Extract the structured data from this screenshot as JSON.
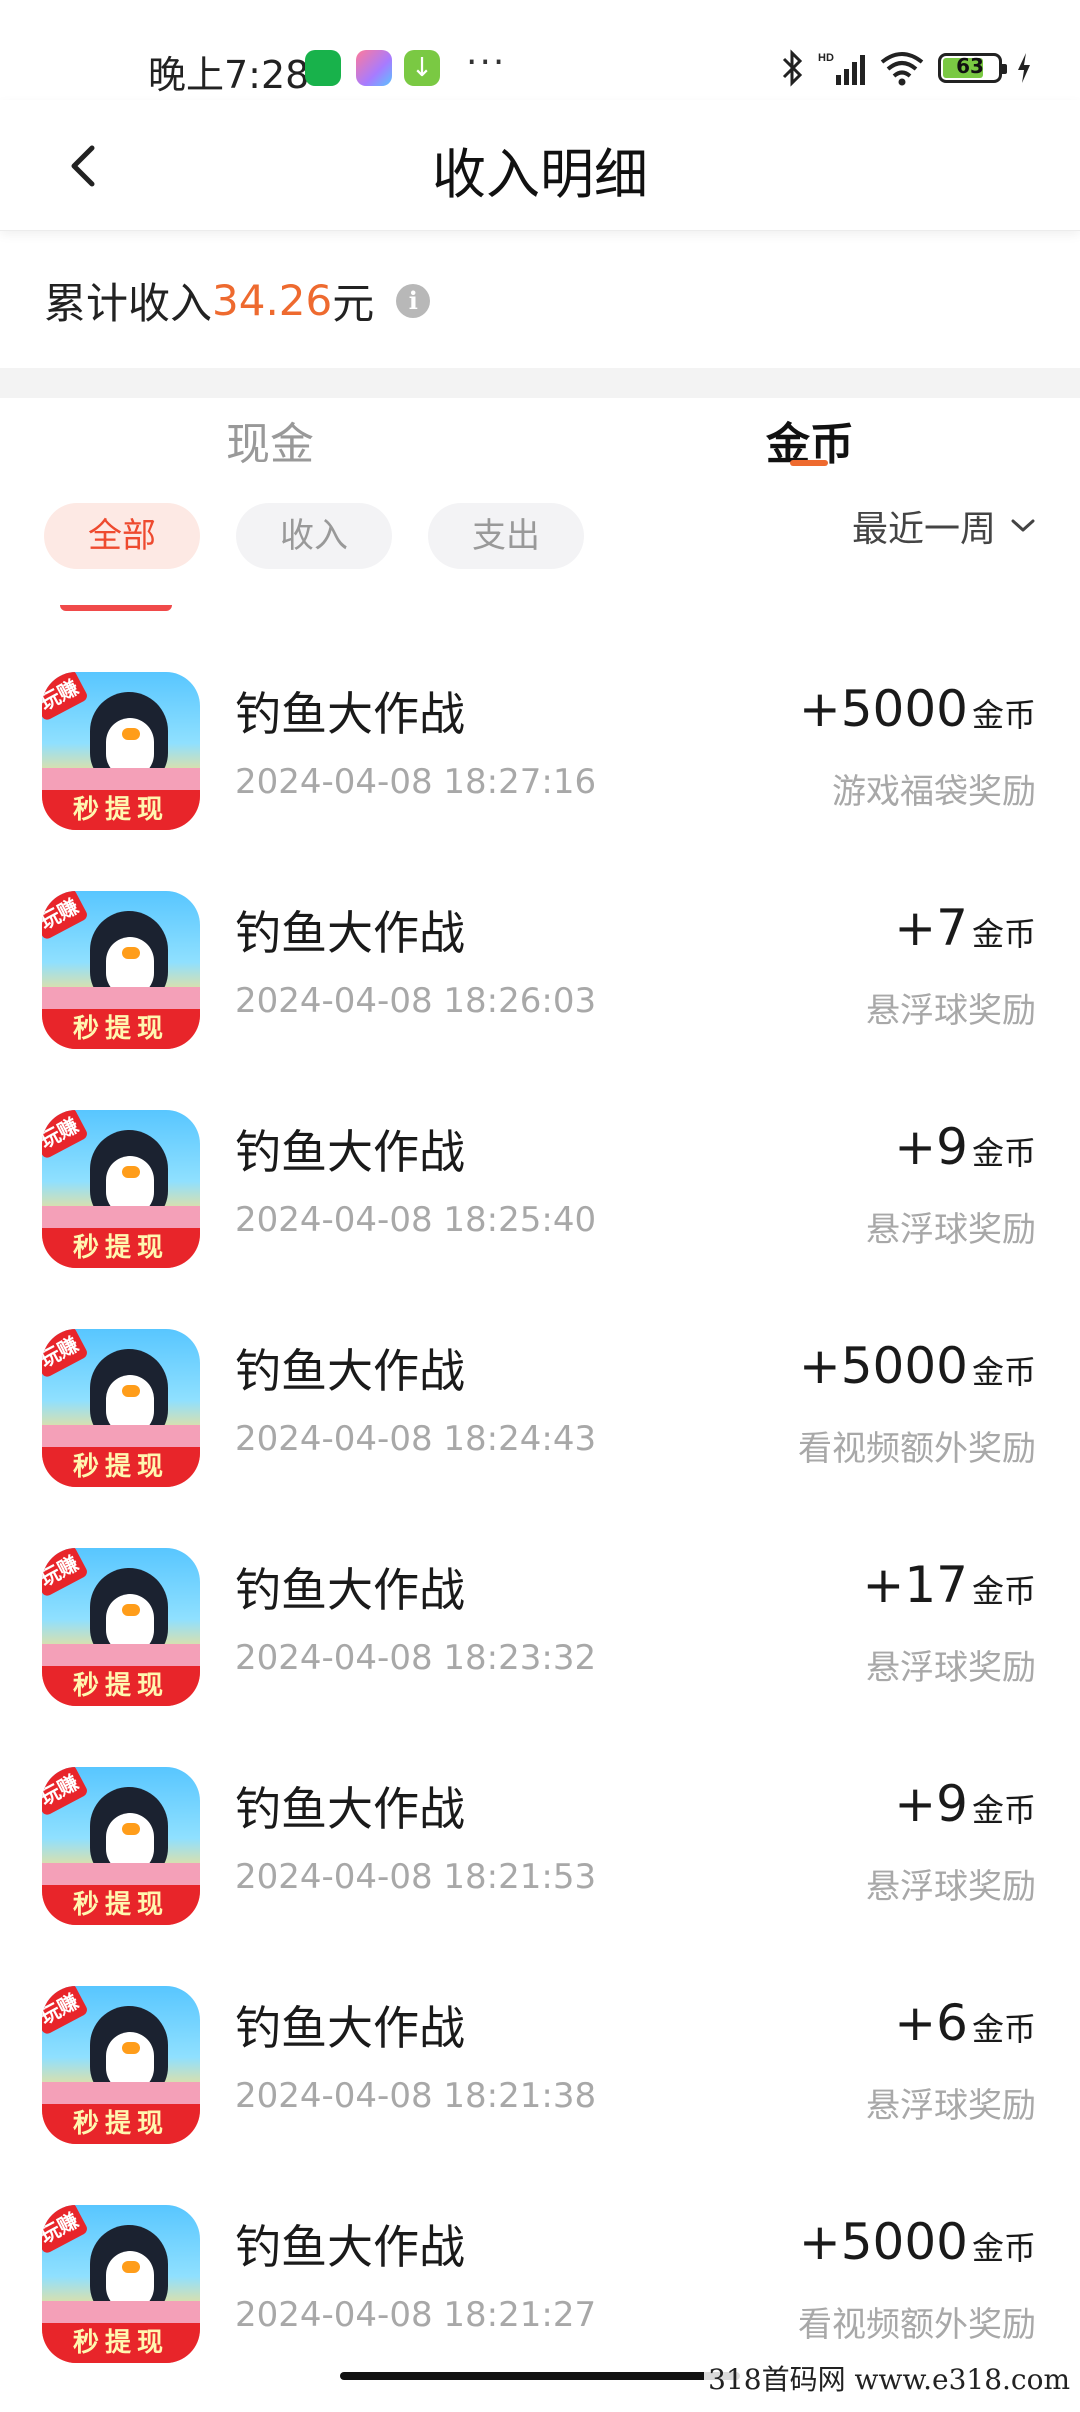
{
  "status_bar": {
    "time": "晚上7:28",
    "more": "···",
    "battery": "63"
  },
  "header": {
    "title": "收入明细"
  },
  "summary": {
    "prefix": "累计收入",
    "amount": "34.26",
    "suffix": "元"
  },
  "tabs": [
    {
      "label": "现金",
      "active": false
    },
    {
      "label": "金币",
      "active": true
    }
  ],
  "filters": [
    {
      "label": "全部",
      "active": true
    },
    {
      "label": "收入",
      "active": false
    },
    {
      "label": "支出",
      "active": false
    }
  ],
  "period": "最近一周",
  "app_icon": {
    "tag": "玩赚",
    "banner": "秒提现"
  },
  "records": [
    {
      "title": "钓鱼大作战",
      "time": "2024-04-08 18:27:16",
      "amount": "+5000",
      "unit": "金币",
      "source": "游戏福袋奖励"
    },
    {
      "title": "钓鱼大作战",
      "time": "2024-04-08 18:26:03",
      "amount": "+7",
      "unit": "金币",
      "source": "悬浮球奖励"
    },
    {
      "title": "钓鱼大作战",
      "time": "2024-04-08 18:25:40",
      "amount": "+9",
      "unit": "金币",
      "source": "悬浮球奖励"
    },
    {
      "title": "钓鱼大作战",
      "time": "2024-04-08 18:24:43",
      "amount": "+5000",
      "unit": "金币",
      "source": "看视频额外奖励"
    },
    {
      "title": "钓鱼大作战",
      "time": "2024-04-08 18:23:32",
      "amount": "+17",
      "unit": "金币",
      "source": "悬浮球奖励"
    },
    {
      "title": "钓鱼大作战",
      "time": "2024-04-08 18:21:53",
      "amount": "+9",
      "unit": "金币",
      "source": "悬浮球奖励"
    },
    {
      "title": "钓鱼大作战",
      "time": "2024-04-08 18:21:38",
      "amount": "+6",
      "unit": "金币",
      "source": "悬浮球奖励"
    },
    {
      "title": "钓鱼大作战",
      "time": "2024-04-08 18:21:27",
      "amount": "+5000",
      "unit": "金币",
      "source": "看视频额外奖励"
    }
  ],
  "watermark": "318首码网 www.e318.com",
  "colors": {
    "accent": "#ee6a2f",
    "chip_active_bg": "#fde9e4",
    "chip_active_text": "#ee4a2f"
  }
}
